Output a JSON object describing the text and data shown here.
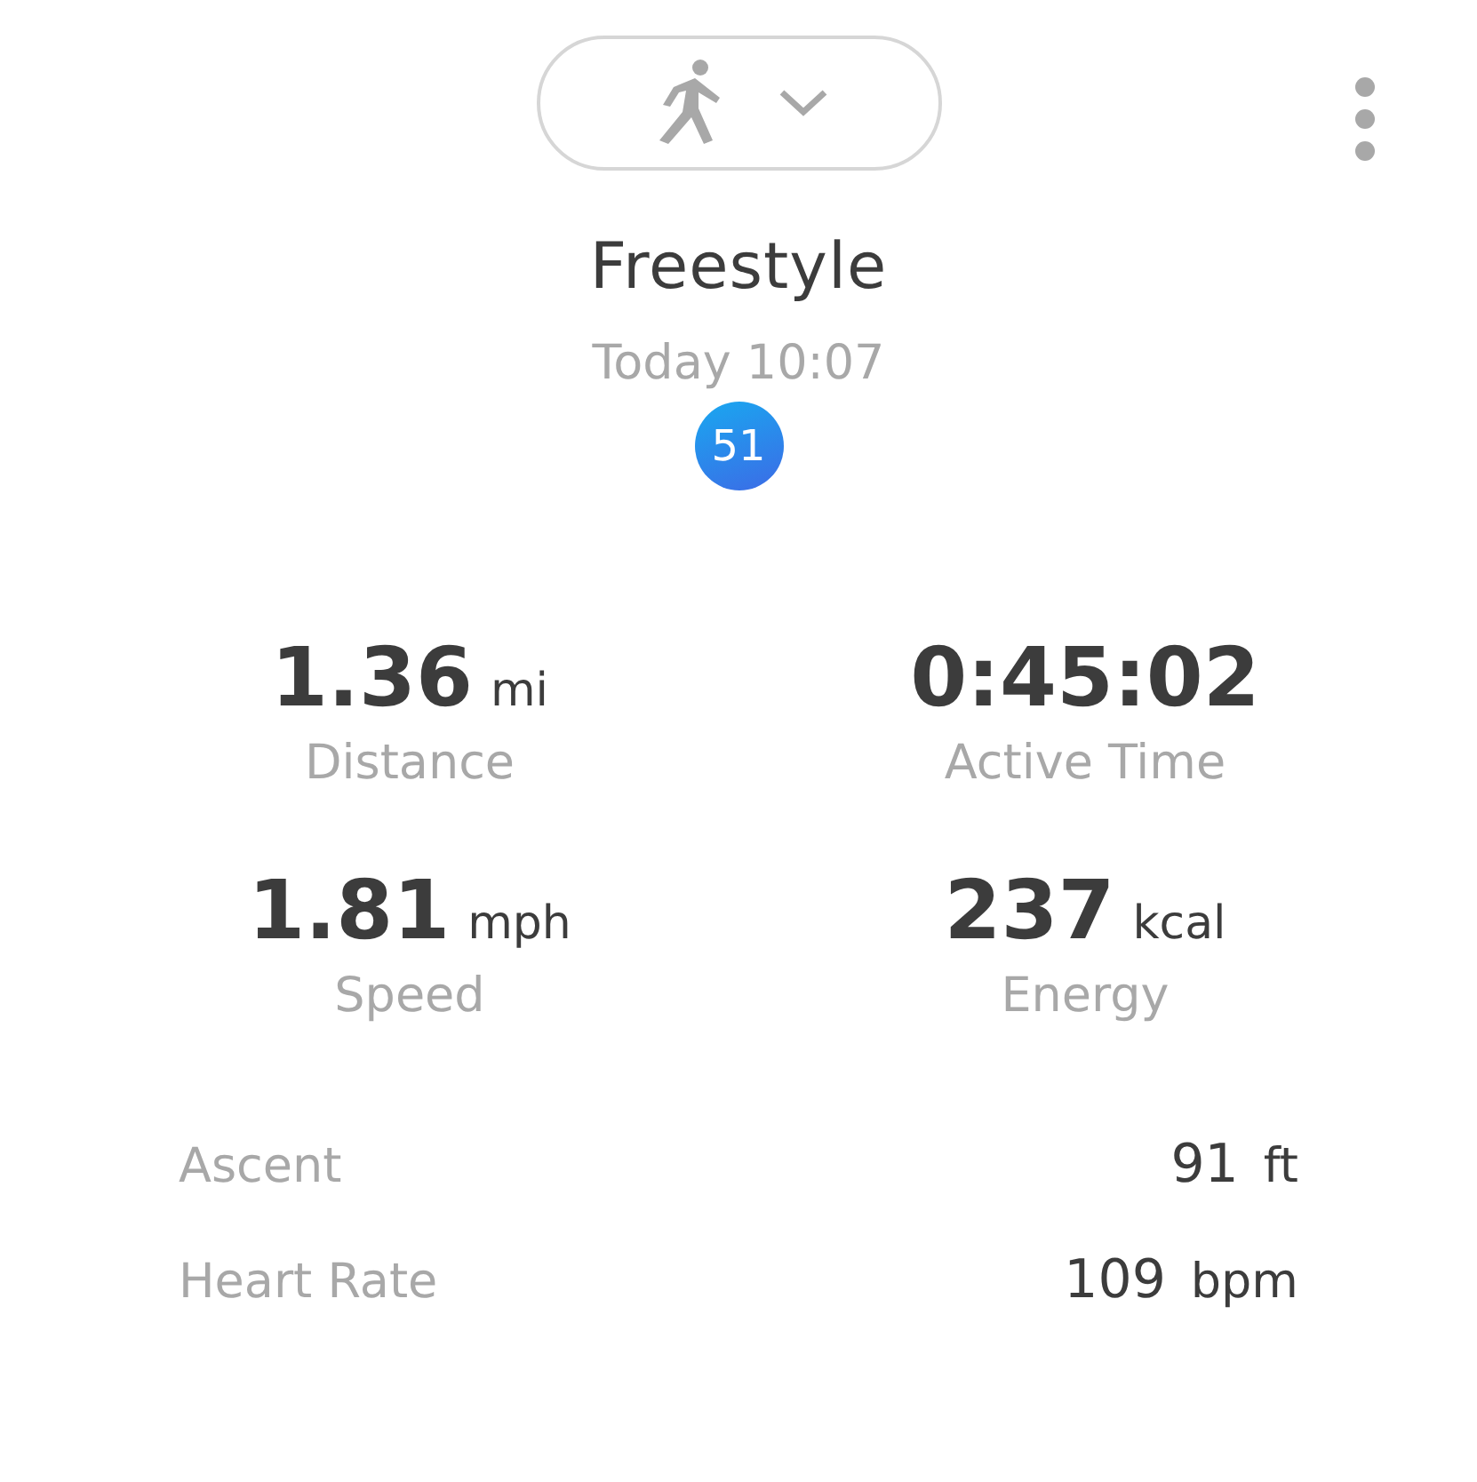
{
  "header": {
    "title": "Freestyle",
    "date": "Today 10:07",
    "badge": "51"
  },
  "stats": [
    {
      "value": "1.36",
      "unit": "mi",
      "label": "Distance"
    },
    {
      "value": "0:45:02",
      "label": "Active Time"
    },
    {
      "value": "1.81",
      "unit": "mph",
      "label": "Speed"
    },
    {
      "value": "237",
      "unit": "kcal",
      "label": "Energy"
    }
  ],
  "details": [
    {
      "label": "Ascent",
      "value": "91",
      "unit": "ft"
    },
    {
      "label": "Heart Rate",
      "value": "109",
      "unit": "bpm"
    }
  ]
}
